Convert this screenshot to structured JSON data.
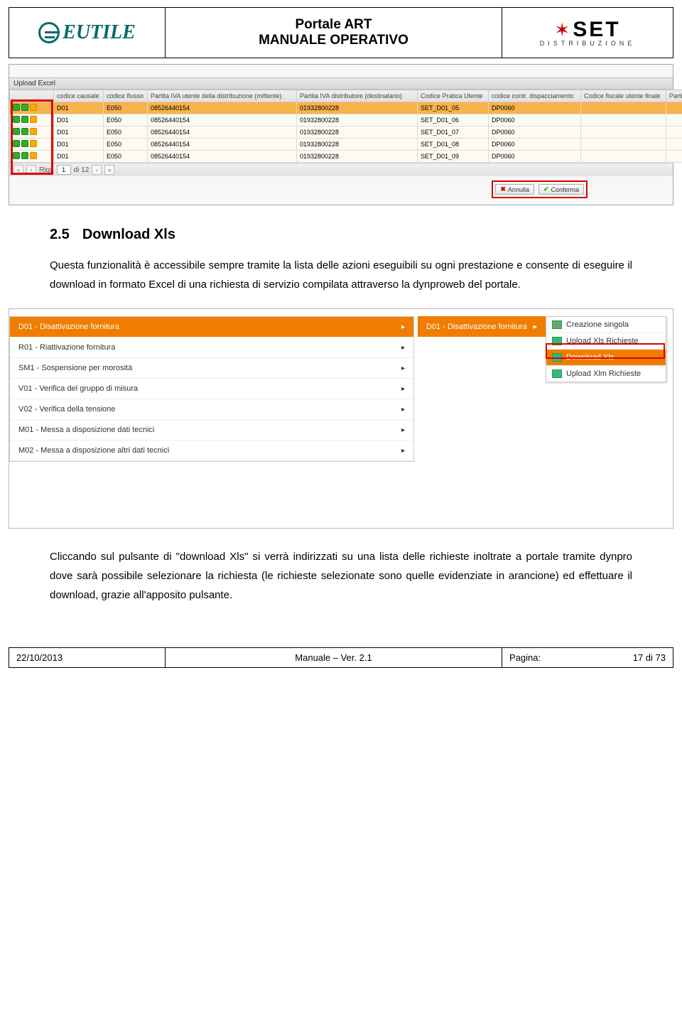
{
  "header": {
    "logo_left": "EUTILE",
    "title1": "Portale ART",
    "title2": "MANUALE OPERATIVO",
    "logo_right_text": "SET",
    "logo_right_sub": "DISTRIBUZIONE"
  },
  "shot1": {
    "upload_label": "Upload Excel",
    "columns": [
      "",
      "codice causale",
      "codice flusso",
      "Partita IVA utente della distribuzione (mittente)",
      "Partita IVA distributore (destinatario)",
      "Codice Pratica Utente",
      "codice contr. dispacciamento",
      "Codice fiscale utente finale",
      "Partita IVA"
    ],
    "rows": [
      {
        "sel": true,
        "c1": "D01",
        "c2": "E050",
        "c3": "08526440154",
        "c4": "01932800228",
        "c5": "SET_D01_05",
        "c6": "DP0060"
      },
      {
        "sel": false,
        "c1": "D01",
        "c2": "E050",
        "c3": "08526440154",
        "c4": "01932800228",
        "c5": "SET_D01_06",
        "c6": "DP0060"
      },
      {
        "sel": false,
        "c1": "D01",
        "c2": "E050",
        "c3": "08526440154",
        "c4": "01932800228",
        "c5": "SET_D01_07",
        "c6": "DP0060"
      },
      {
        "sel": false,
        "c1": "D01",
        "c2": "E050",
        "c3": "08526440154",
        "c4": "01932800228",
        "c5": "SET_D01_08",
        "c6": "DP0060"
      },
      {
        "sel": false,
        "c1": "D01",
        "c2": "E050",
        "c3": "08526440154",
        "c4": "01932800228",
        "c5": "SET_D01_09",
        "c6": "DP0060"
      }
    ],
    "pager": {
      "riga_label": "Riga",
      "riga_value": "1",
      "riga_tot": "di 12"
    },
    "btn_cancel": "Annulla",
    "btn_confirm": "Conferma"
  },
  "section": {
    "num": "2.5",
    "title": "Download Xls",
    "p1": "Questa funzionalità è accessibile sempre tramite la lista delle azioni eseguibili su ogni prestazione e consente di eseguire il download in formato Excel di una richiesta di servizio compilata attraverso la dynproweb del portale.",
    "p2": "Cliccando sul pulsante di \"download Xls\" si verrà indirizzati su una lista delle richieste inoltrate a portale tramite dynpro dove sarà possibile selezionare la richiesta (le richieste selezionate sono quelle evidenziate in arancione) ed effettuare il download, grazie all'apposito pulsante."
  },
  "shot2": {
    "left_active": "D01 - Disattivazione fornitura",
    "left_items": [
      "R01 - Riattivazione fornitura",
      "SM1 - Sospensione per morosità",
      "V01 - Verifica del gruppo di misura",
      "V02 - Verifica della tensione",
      "M01 - Messa a disposizione dati tecnici",
      "M02 - Messa a disposizione altri dati tecnici"
    ],
    "flyout_label": "D01 - Disattivazione fornitura",
    "sub_items": [
      "Creazione singola",
      "Upload Xls Richieste",
      "Download Xls",
      "Upload Xlm Richieste"
    ]
  },
  "footer": {
    "date": "22/10/2013",
    "manual": "Manuale – Ver. 2.1",
    "page_label": "Pagina:",
    "page_value": "17 di 73"
  }
}
